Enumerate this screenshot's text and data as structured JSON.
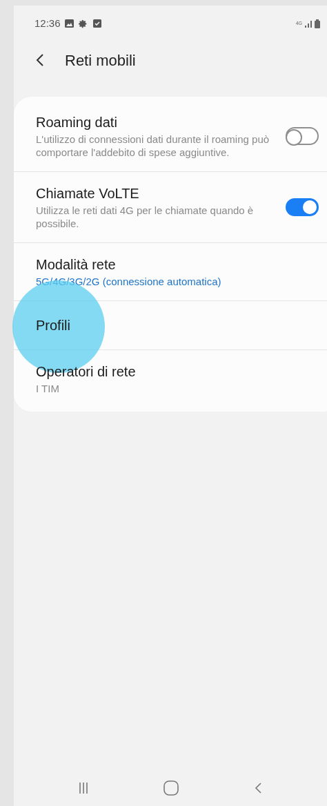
{
  "status_bar": {
    "time": "12:36",
    "network": "4G"
  },
  "header": {
    "title": "Reti mobili"
  },
  "items": [
    {
      "kind": "toggle",
      "title": "Roaming dati",
      "subtitle": "L'utilizzo di connessioni dati durante il roaming può comportare l'addebito di spese aggiuntive.",
      "on": false
    },
    {
      "kind": "toggle",
      "title": "Chiamate VoLTE",
      "subtitle": "Utilizza le reti dati 4G per le chiamate quando è possibile.",
      "on": true
    },
    {
      "kind": "value",
      "title": "Modalità rete",
      "subtitle": "5G/4G/3G/2G (connessione automatica)"
    },
    {
      "kind": "link",
      "title": "Profili",
      "touched": true
    },
    {
      "kind": "summary",
      "title": "Operatori di rete",
      "subtitle": "I TIM"
    }
  ]
}
